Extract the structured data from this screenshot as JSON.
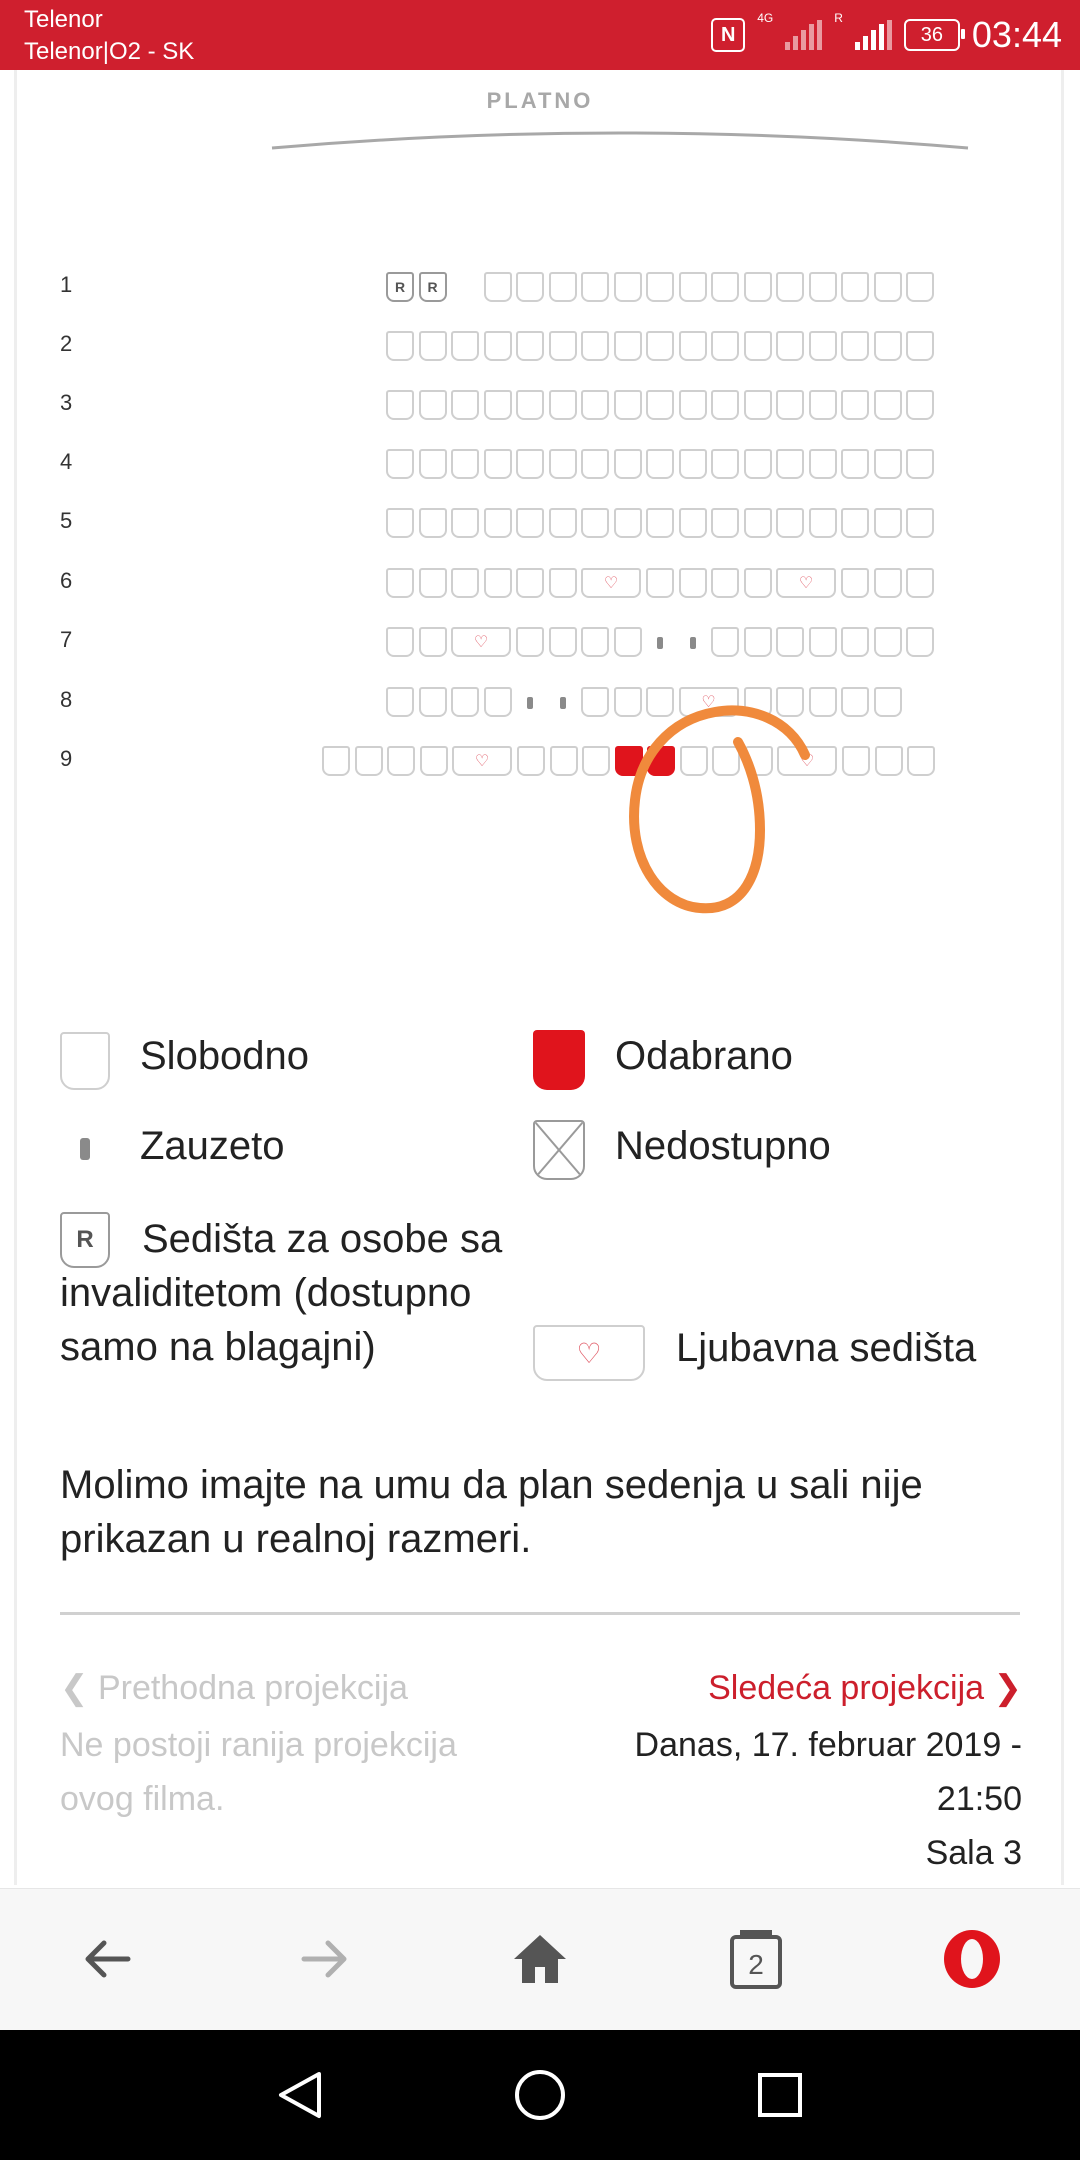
{
  "status_bar": {
    "carrier_line1": "Telenor",
    "carrier_line2": "Telenor|O2 - SK",
    "nfc": "N",
    "network": "4G",
    "roaming": "R",
    "battery": "36",
    "time": "03:44",
    "background": "#cf1f2e"
  },
  "seat_map": {
    "screen_label": "PLATNO",
    "rows": [
      {
        "number": "1",
        "seats": [
          "R",
          "R",
          "gap",
          "s",
          "s",
          "s",
          "s",
          "s",
          "s",
          "s",
          "s",
          "s",
          "s",
          "s",
          "s",
          "s",
          "s"
        ]
      },
      {
        "number": "2"
      },
      {
        "number": "3"
      },
      {
        "number": "4"
      },
      {
        "number": "5"
      },
      {
        "number": "6"
      },
      {
        "number": "7"
      },
      {
        "number": "8"
      },
      {
        "number": "9"
      }
    ],
    "selected_seats": "row 9, 2 seats",
    "accent": "#e0141c"
  },
  "legend": {
    "free": "Slobodno",
    "selected": "Odabrano",
    "occupied": "Zauzeto",
    "unavailable": "Nedostupno",
    "r_glyph": "R",
    "disabled": "Sedišta za osobe sa invaliditetom (dostupno samo na blagajni)",
    "love": "Ljubavna sedišta"
  },
  "note": "Molimo imajte na umu da plan sedenja u sali nije prikazan u realnoj razmeri.",
  "navigation": {
    "prev_label": "Prethodna projekcija",
    "prev_desc": "Ne postoji ranija projekcija ovog filma.",
    "next_label": "Sledeća projekcija",
    "next_line1": "Danas, 17. februar 2019 -",
    "next_line2": "21:50",
    "next_line3": "Sala 3"
  },
  "browser_bar": {
    "tab_count": "2",
    "icons": [
      "back-icon",
      "forward-icon",
      "home-icon",
      "tabs-icon",
      "opera-menu-icon"
    ]
  },
  "android_nav": {
    "icons": [
      "back-triangle-icon",
      "home-circle-icon",
      "recents-square-icon"
    ]
  }
}
